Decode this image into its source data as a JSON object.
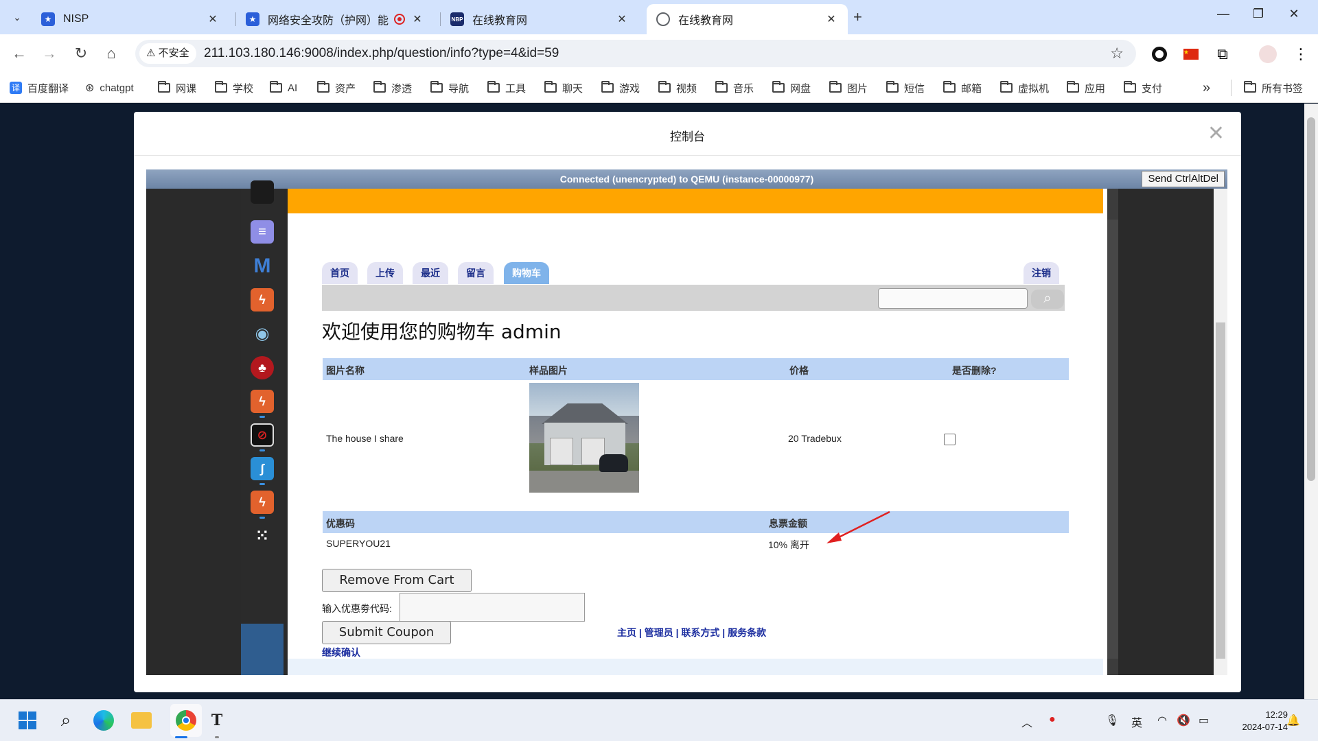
{
  "browser": {
    "tabs": [
      {
        "title": "NISP",
        "favicon_color": "#2b5fd9"
      },
      {
        "title": "网络安全攻防（护网）能力",
        "favicon_color": "#2b5fd9"
      },
      {
        "title": "在线教育网",
        "favicon_color": "#1a2b6b"
      },
      {
        "title": "在线教育网",
        "favicon_color": "#5f6368",
        "active": true
      }
    ],
    "security_label": "不安全",
    "url": "211.103.180.146:9008/index.php/question/info?type=4&id=59",
    "bookmarks": [
      "百度翻译",
      "chatgpt",
      "网课",
      "学校",
      "AI",
      "资产",
      "渗透",
      "导航",
      "工具",
      "聊天",
      "游戏",
      "视频",
      "音乐",
      "网盘",
      "图片",
      "短信",
      "邮箱",
      "虚拟机",
      "应用",
      "支付"
    ],
    "all_bookmarks": "所有书签",
    "more_bookmarks": "»"
  },
  "modal": {
    "title": "控制台",
    "vnc_status": "Connected (unencrypted) to QEMU (instance-00000977)",
    "send_ctrl_alt_del": "Send CtrlAltDel"
  },
  "site": {
    "nav_tabs": [
      "首页",
      "上传",
      "最近",
      "留言",
      "购物车"
    ],
    "active_tab": "购物车",
    "logout": "注销",
    "welcome": "欢迎使用您的购物车 admin",
    "cart_headers": [
      "图片名称",
      "样品图片",
      "价格",
      "是否删除?"
    ],
    "cart_items": [
      {
        "name": "The house I share",
        "price": "20 Tradebux",
        "delete_checked": false
      }
    ],
    "coupon_headers": [
      "优惠码",
      "息票金额"
    ],
    "coupons": [
      {
        "code": "SUPERYOU21",
        "amount": "10% 离开"
      }
    ],
    "remove_button": "Remove From Cart",
    "coupon_label": "输入优惠劵代码:",
    "coupon_value": "",
    "submit_button": "Submit Coupon",
    "footer_links": [
      "主页",
      "管理员",
      "联系方式",
      "服务条款"
    ],
    "continue_link": "继续确认"
  },
  "taskbar": {
    "tray_ime": "英",
    "time": "12:29",
    "date": "2024-07-14"
  },
  "colors": {
    "banner": "#ffa500",
    "table_header": "#bcd4f5",
    "active_tab": "#7fb3ea",
    "link": "#1c2ea0",
    "annotation_arrow": "#e02020"
  }
}
